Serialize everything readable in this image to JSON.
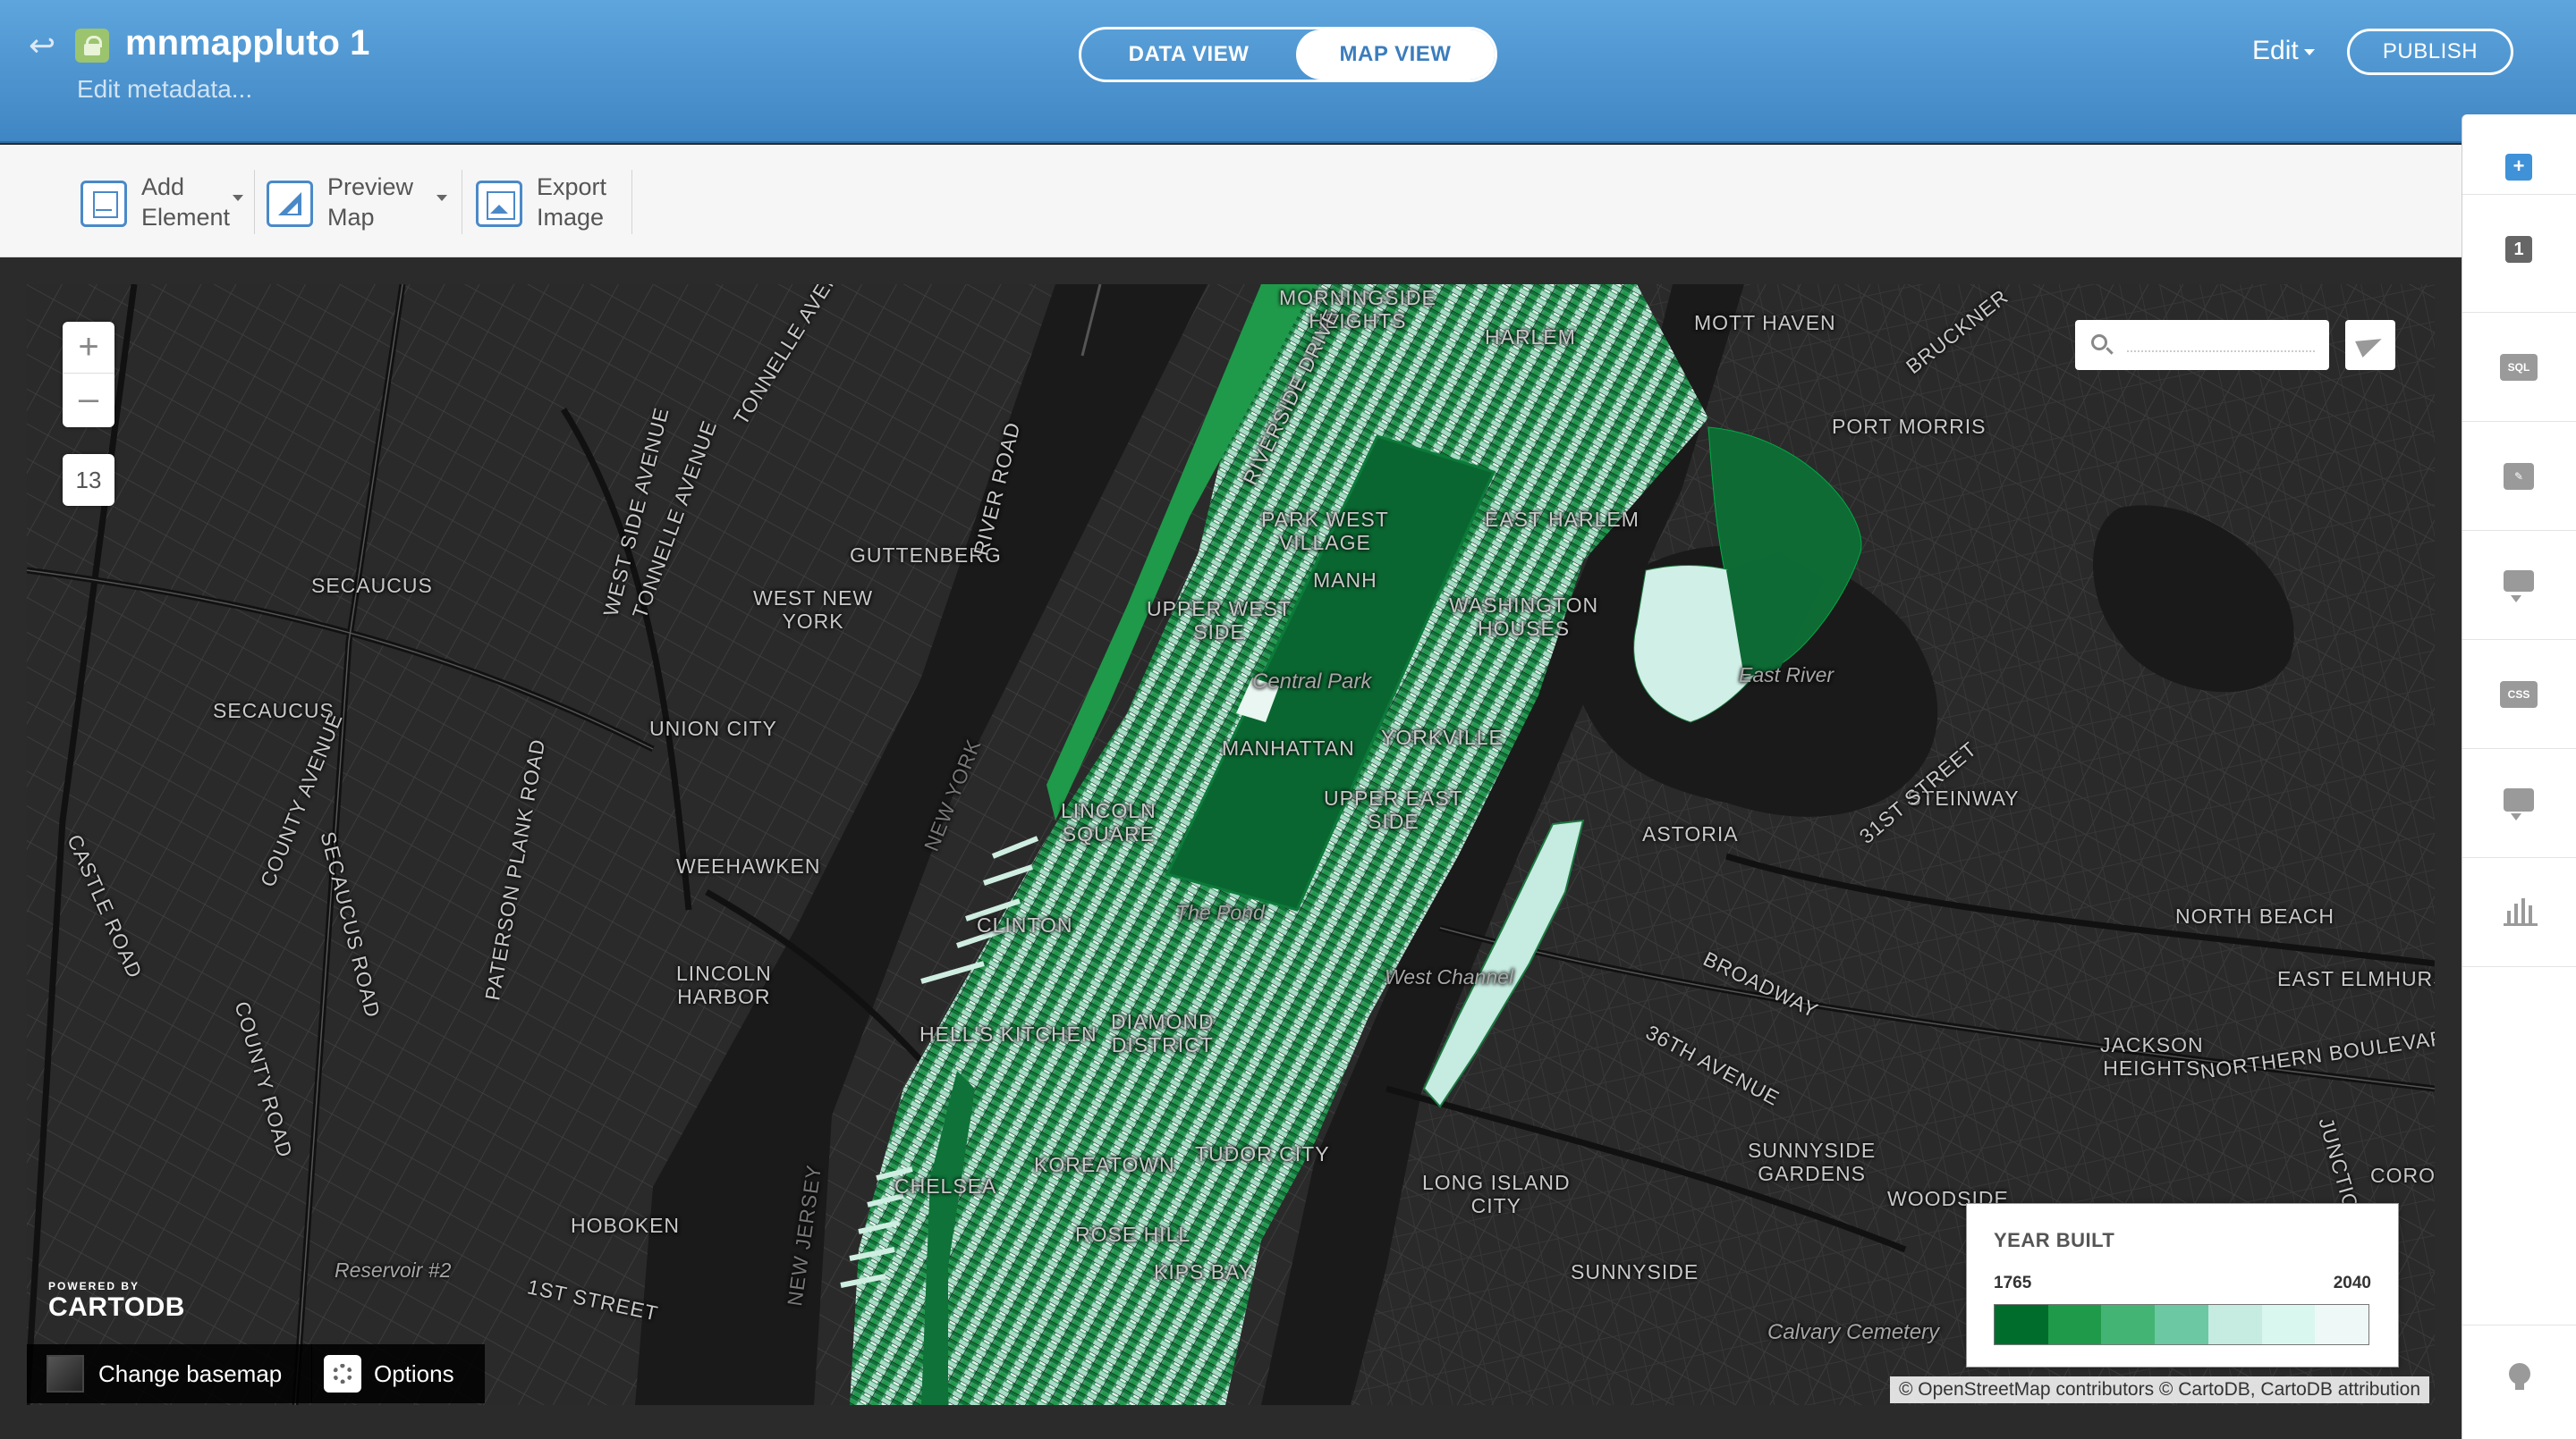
{
  "header": {
    "title": "mnmappluto 1",
    "subtitle": "Edit metadata...",
    "view_toggle": {
      "data_view": "DATA VIEW",
      "map_view": "MAP VIEW",
      "active": "MAP VIEW"
    },
    "edit_label": "Edit",
    "publish_label": "PUBLISH",
    "accent_color": "#3f86c4"
  },
  "toolbar": {
    "add_element": {
      "line1": "Add",
      "line2": "Element",
      "icon": "add-element-icon"
    },
    "preview_map": {
      "line1": "Preview",
      "line2": "Map",
      "icon": "preview-map-icon"
    },
    "export_image": {
      "line1": "Export",
      "line2": "Image",
      "icon": "export-image-icon"
    }
  },
  "sidebar": {
    "items": [
      {
        "name": "add-layer",
        "label": "+",
        "icon": "plus-icon"
      },
      {
        "name": "layer-1",
        "label": "1",
        "icon": "layer-number-icon"
      },
      {
        "name": "sql",
        "label": "SQL",
        "icon": "sql-icon"
      },
      {
        "name": "wizards",
        "label": "",
        "icon": "brush-icon"
      },
      {
        "name": "infowindow",
        "label": "",
        "icon": "infowindow-icon"
      },
      {
        "name": "css",
        "label": "CSS",
        "icon": "css-icon"
      },
      {
        "name": "legends",
        "label": "",
        "icon": "legend-icon"
      },
      {
        "name": "filters",
        "label": "",
        "icon": "filters-icon"
      },
      {
        "name": "tips",
        "label": "",
        "icon": "lightbulb-icon"
      }
    ]
  },
  "map": {
    "zoom_in": "+",
    "zoom_out": "–",
    "zoom_level": "13",
    "powered_by": "POWERED BY",
    "brand": "CARTODB",
    "change_basemap": "Change basemap",
    "options": "Options",
    "attribution": "© OpenStreetMap contributors © CartoDB, CartoDB attribution",
    "labels": {
      "morningside": "MORNINGSIDE\nHEIGHTS",
      "harlem": "HARLEM",
      "mott_haven": "MOTT HAVEN",
      "port_morris": "PORT MORRIS",
      "guttenberg": "GUTTENBERG",
      "west_new_york": "WEST NEW\nYORK",
      "secaucus1": "SECAUCUS",
      "secaucus2": "SECAUCUS",
      "union_city": "UNION CITY",
      "weehawken": "WEEHAWKEN",
      "lincoln_harbor": "LINCOLN\nHARBOR",
      "hoboken": "HOBOKEN",
      "park_west": "PARK WEST\nVILLAGE",
      "manh": "MANH",
      "upper_west": "UPPER WEST\nSIDE",
      "central_park": "Central Park",
      "manhattan": "MANHATTAN",
      "yorkville": "YORKVILLE",
      "upper_east": "UPPER EAST\nSIDE",
      "east_harlem": "EAST HARLEM",
      "washington": "WASHINGTON\nHOUSES",
      "lincoln_sq": "LINCOLN\nSQUARE",
      "clinton": "CLINTON",
      "hells_kitchen": "HELL'S KITCHEN",
      "diamond": "DIAMOND\nDISTRICT",
      "tudor": "TUDOR CITY",
      "koreatown": "KOREATOWN",
      "chelsea": "CHELSEA",
      "rose_hill": "ROSE HILL",
      "kips_bay": "KIPS BAY",
      "the_pond": "The Pond",
      "east_river": "East River",
      "west_channel": "West Channel",
      "astoria": "ASTORIA",
      "steinway": "STEINWAY",
      "north_beach": "NORTH BEACH",
      "east_elmhurst": "EAST ELMHURS",
      "jackson": "JACKSON\nHEIGHTS",
      "northern": "NORTHERN BOULEVARD",
      "sunnyside_gardens": "SUNNYSIDE\nGARDENS",
      "woodside": "WOODSIDE",
      "sunnyside": "SUNNYSIDE",
      "lic": "LONG ISLAND\nCITY",
      "calvary": "Calvary Cemetery",
      "reservoir": "Reservoir #2",
      "first_street": "1ST STREET",
      "broadway": "BROADWAY",
      "av36": "36TH AVENUE",
      "st31": "31ST STREET",
      "coro": "CORO",
      "new_york": "NEW YORK",
      "new_jersey": "NEW JERSEY",
      "tonnelle1": "TONNELLE AVENUE",
      "tonnelle2": "TONNELLE AVENUE",
      "west_side_ave": "WEST SIDE AVENUE",
      "river_road": "RIVER ROAD",
      "paterson": "PATERSON PLANK ROAD",
      "county_ave": "COUNTY AVENUE",
      "secaucus_rd": "SECAUCUS ROAD",
      "castle": "CASTLE ROAD",
      "county_rd": "COUNTY ROAD",
      "bruckner": "BRUCKNER",
      "riverside": "RIVERSIDE DRIVE",
      "junction": "JUNCTION BOU"
    },
    "legend": {
      "title": "YEAR BUILT",
      "min": "1765",
      "max": "2040",
      "colors": [
        "#006d2c",
        "#1f9a4a",
        "#43b474",
        "#6bc8a3",
        "#c6ebe0",
        "#d9f7ee",
        "#eef8f7"
      ]
    }
  }
}
